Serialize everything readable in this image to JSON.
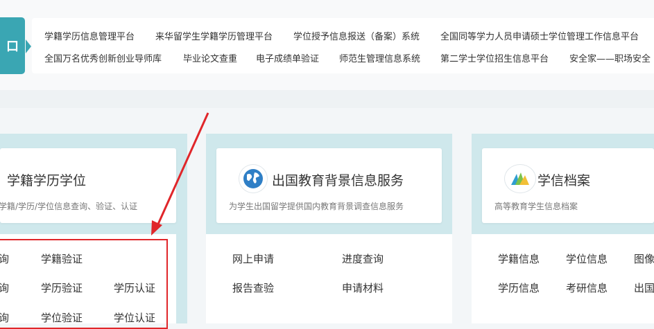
{
  "top_tab_label": "口",
  "top_links": {
    "row1": [
      "学籍学历信息管理平台",
      "来华留学生学籍学历管理平台",
      "学位授予信息报送（备案）系统",
      "全国同等学力人员申请硕士学位管理工作信息平台"
    ],
    "row2": [
      "全国万名优秀创新创业导师库",
      "毕业论文查重",
      "电子成绩单验证",
      "师范生管理信息系统",
      "第二学士学位招生信息平台",
      "安全家——职场安全"
    ]
  },
  "cards": [
    {
      "title": "学籍学历学位",
      "subtitle": "学籍/学历/学位信息查询、验证、认证",
      "items": [
        [
          "询",
          "学籍验证",
          ""
        ],
        [
          "询",
          "学历验证",
          "学历认证"
        ],
        [
          "询",
          "学位验证",
          "学位认证"
        ]
      ]
    },
    {
      "title": "出国教育背景信息服务",
      "subtitle": "为学生出国留学提供国内教育背景调查信息服务",
      "icon": "globe-icon",
      "items": [
        [
          "网上申请",
          "进度查询"
        ],
        [
          "报告查验",
          "申请材料"
        ]
      ]
    },
    {
      "title": "学信档案",
      "subtitle": "高等教育学生信息档案",
      "icon": "archive-icon",
      "items": [
        [
          "学籍信息",
          "学位信息",
          "图像"
        ],
        [
          "学历信息",
          "考研信息",
          "出国"
        ]
      ]
    }
  ],
  "colors": {
    "accent": "#3aa6b3",
    "card_background": "#cfe8ec",
    "annotation_red": "#e0262a"
  }
}
